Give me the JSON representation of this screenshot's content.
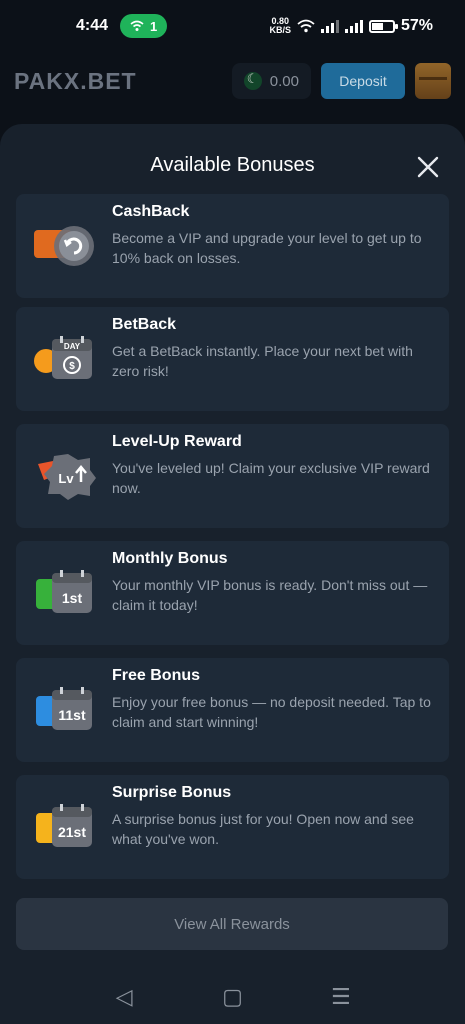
{
  "status_bar": {
    "time": "4:44",
    "hotspot_count": "1",
    "net_speed_value": "0.80",
    "net_speed_unit": "KB/S",
    "battery": "57%",
    "battery_level": 0.57
  },
  "header": {
    "logo_left": "PAK",
    "logo_x": "X",
    "logo_right": ".BET",
    "balance": "0.00",
    "deposit_label": "Deposit"
  },
  "modal": {
    "title": "Available Bonuses",
    "view_all_label": "View All Rewards",
    "bonuses": [
      {
        "title": "CashBack",
        "description": "Become a VIP and upgrade your level to get up to 10% back on losses.",
        "icon": "cashback-icon",
        "color": "#e06a1f"
      },
      {
        "title": "BetBack",
        "description": "Get a BetBack instantly. Place your next bet with zero risk!",
        "icon": "calendar-day-icon",
        "badge": "DAY",
        "color": "#f59b1c"
      },
      {
        "title": "Level-Up Reward",
        "description": "You've leveled up! Claim your exclusive VIP reward now.",
        "icon": "level-up-icon",
        "badge": "Lv",
        "color": "#e8552b"
      },
      {
        "title": "Monthly Bonus",
        "description": "Your monthly VIP bonus is ready. Don't miss out — claim it today!",
        "icon": "calendar-1st-icon",
        "badge": "1st",
        "color": "#37b13b"
      },
      {
        "title": "Free Bonus",
        "description": "Enjoy your free bonus — no deposit needed. Tap to claim and start winning!",
        "icon": "calendar-11st-icon",
        "badge": "11st",
        "color": "#2d8de0"
      },
      {
        "title": "Surprise Bonus",
        "description": "A surprise bonus just for you! Open now and see what you've won.",
        "icon": "calendar-21st-icon",
        "badge": "21st",
        "color": "#f5b31c"
      }
    ]
  }
}
